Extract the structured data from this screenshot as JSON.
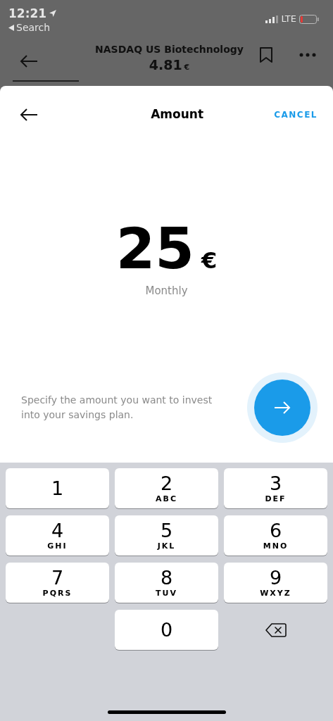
{
  "status_bar": {
    "time": "12:21",
    "back_label": "Search",
    "network": "LTE"
  },
  "header": {
    "title": "NASDAQ US Biotechnology",
    "price": "4.81",
    "currency": "€"
  },
  "sheet": {
    "title": "Amount",
    "cancel": "CANCEL",
    "amount": "25",
    "currency": "€",
    "frequency": "Monthly",
    "hint": "Specify the amount you want to invest into your savings plan."
  },
  "keypad": [
    {
      "kind": "digit",
      "digit": "1"
    },
    {
      "kind": "digit",
      "digit": "2",
      "letters": "ABC"
    },
    {
      "kind": "digit",
      "digit": "3",
      "letters": "DEF"
    },
    {
      "kind": "digit",
      "digit": "4",
      "letters": "GHI"
    },
    {
      "kind": "digit",
      "digit": "5",
      "letters": "JKL"
    },
    {
      "kind": "digit",
      "digit": "6",
      "letters": "MNO"
    },
    {
      "kind": "digit",
      "digit": "7",
      "letters": "PQRS"
    },
    {
      "kind": "digit",
      "digit": "8",
      "letters": "TUV"
    },
    {
      "kind": "digit",
      "digit": "9",
      "letters": "WXYZ"
    },
    {
      "kind": "blank"
    },
    {
      "kind": "digit",
      "digit": "0"
    },
    {
      "kind": "backspace"
    }
  ]
}
